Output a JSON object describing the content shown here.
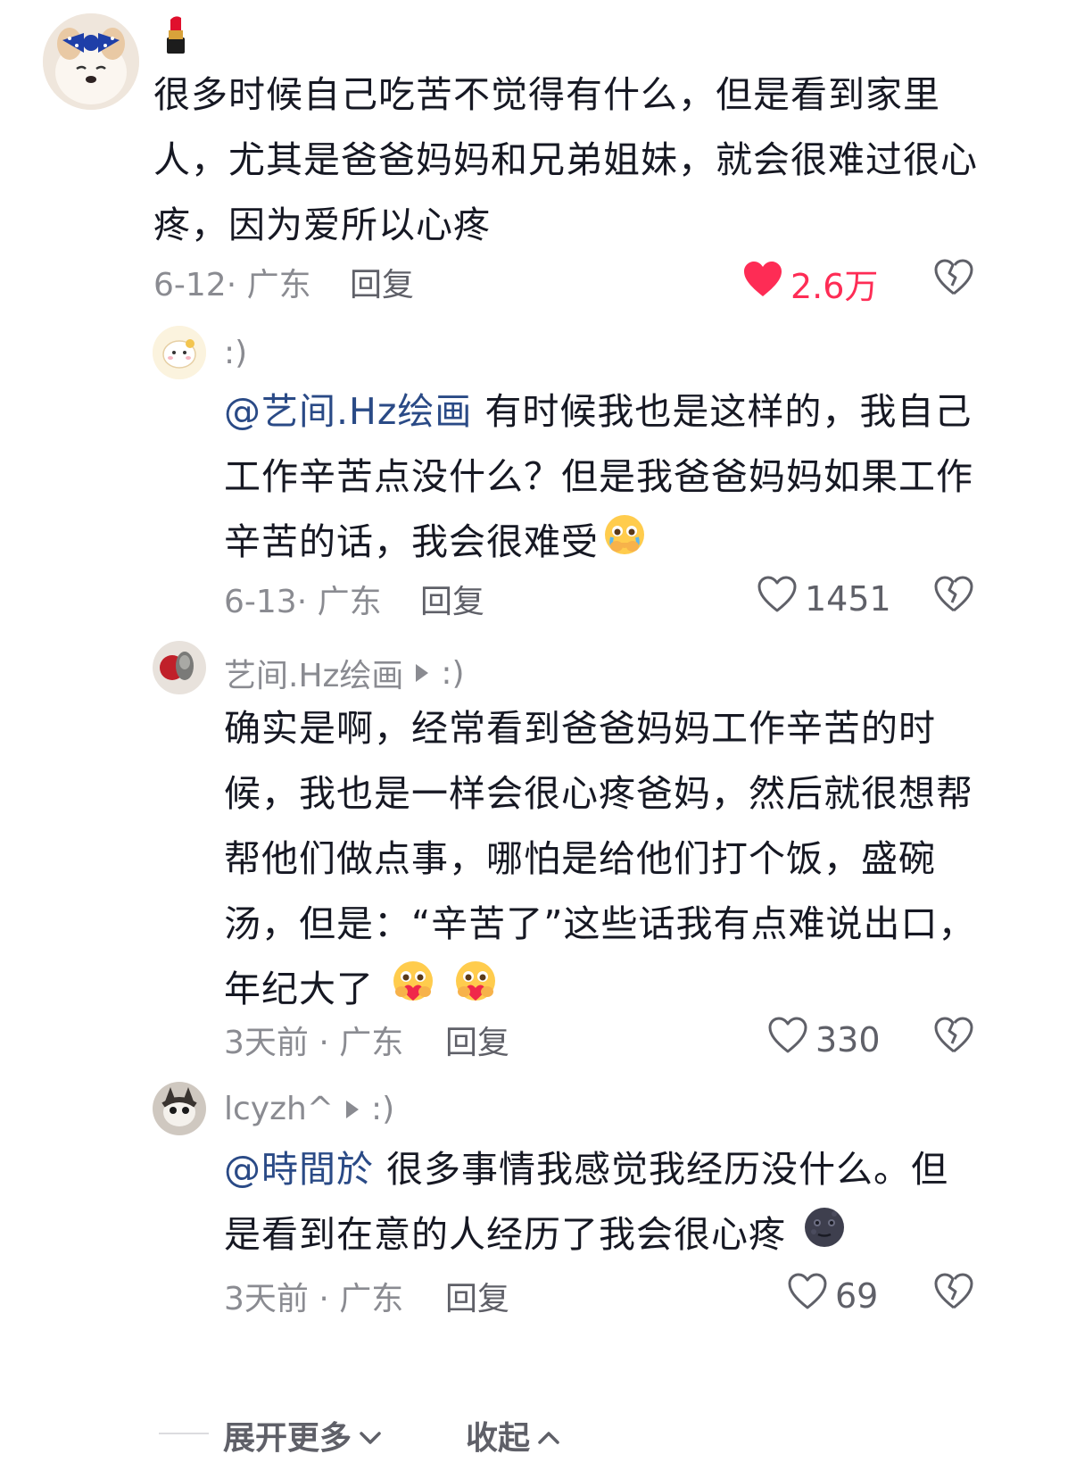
{
  "main_comment": {
    "username_badge": "lipstick-emoji",
    "text": "很多时候自己吃苦不觉得有什么，但是看到家里人，尤其是爸爸妈妈和兄弟姐妹，就会很难过很心疼，因为爱所以心疼",
    "lines": [
      "很多时候自己吃苦不觉得有什么，但是看到家里",
      "人，尤其是爸爸妈妈和兄弟姐妹，就会很难过很心",
      "疼，因为爱所以心疼"
    ],
    "meta": "6-12· 广东",
    "reply_label": "回复",
    "likes": "2.6万",
    "liked": true
  },
  "replies": [
    {
      "name": ":)",
      "mention": "@艺间.Hz绘画",
      "lines": [
        " 有时候我也是这样的，我自己",
        "工作辛苦点没什么？但是我爸爸妈妈如果工作",
        "辛苦的话，我会很难受"
      ],
      "meta": "6-13· 广东",
      "reply_label": "回复",
      "likes": "1451"
    },
    {
      "name": "艺间.Hz绘画",
      "reply_to": ":)",
      "lines": [
        "确实是啊，经常看到爸爸妈妈工作辛苦的时",
        "候，我也是一样会很心疼爸妈，然后就很想帮",
        "帮他们做点事，哪怕是给他们打个饭，盛碗",
        "汤，但是：“辛苦了”这些话我有点难说出口，",
        "年纪大了"
      ],
      "meta": "3天前 · 广东",
      "reply_label": "回复",
      "likes": "330"
    },
    {
      "name": "lcyzh^",
      "reply_to": ":)",
      "mention": "@時間於",
      "lines": [
        " 很多事情我感觉我经历没什么。但",
        "是看到在意的人经历了我会很心疼"
      ],
      "meta": "3天前 · 广东",
      "reply_label": "回复",
      "likes": "69"
    }
  ],
  "footer": {
    "expand_label": "展开更多",
    "collapse_label": "收起"
  },
  "colors": {
    "text": "#161823",
    "secondary": "#8a8b91",
    "mention": "#2a4a86",
    "liked": "#fe2c55"
  }
}
